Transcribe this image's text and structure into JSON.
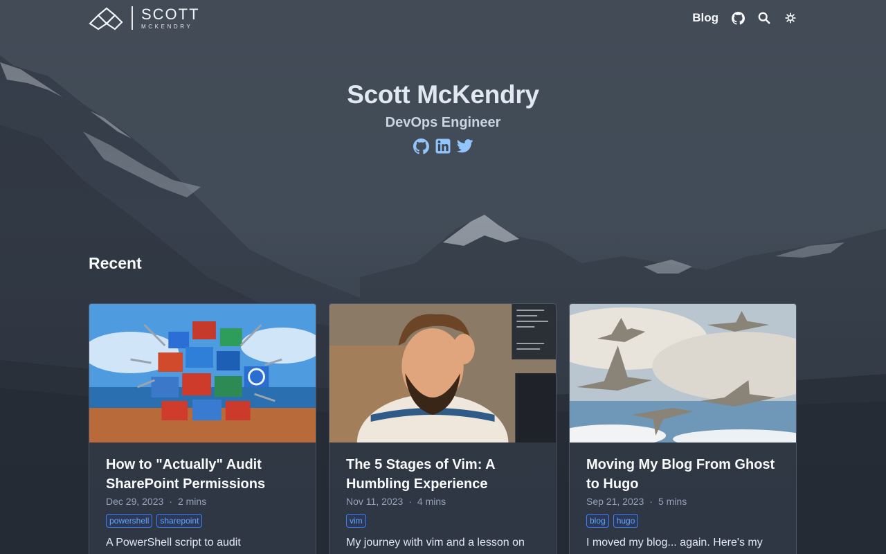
{
  "header": {
    "logo_name": "SCOTT",
    "logo_sub": "MCKENDRY",
    "nav_blog": "Blog",
    "icons": [
      "github-icon",
      "search-icon",
      "theme-toggle-icon"
    ]
  },
  "hero": {
    "name": "Scott McKendry",
    "role": "DevOps Engineer",
    "socials": [
      "github-icon",
      "linkedin-icon",
      "twitter-icon"
    ]
  },
  "recent": {
    "title": "Recent",
    "posts": [
      {
        "title": "How to \"Actually\" Audit SharePoint Permissions",
        "date": "Dec 29, 2023",
        "read_time": "2 mins",
        "tags": [
          "powershell",
          "sharepoint"
        ],
        "summary": "A PowerShell script to audit"
      },
      {
        "title": "The 5 Stages of Vim: A Humbling Experience",
        "date": "Nov 11, 2023",
        "read_time": "4 mins",
        "tags": [
          "vim"
        ],
        "summary": "My journey with vim and a lesson on"
      },
      {
        "title": "Moving My Blog From Ghost to Hugo",
        "date": "Sep 21, 2023",
        "read_time": "5 mins",
        "tags": [
          "blog",
          "hugo"
        ],
        "summary": "I moved my blog... again. Here's my"
      }
    ]
  },
  "colors": {
    "accent": "#3b82f6",
    "tag_text": "#60a5fa",
    "background": "#2a313c"
  }
}
